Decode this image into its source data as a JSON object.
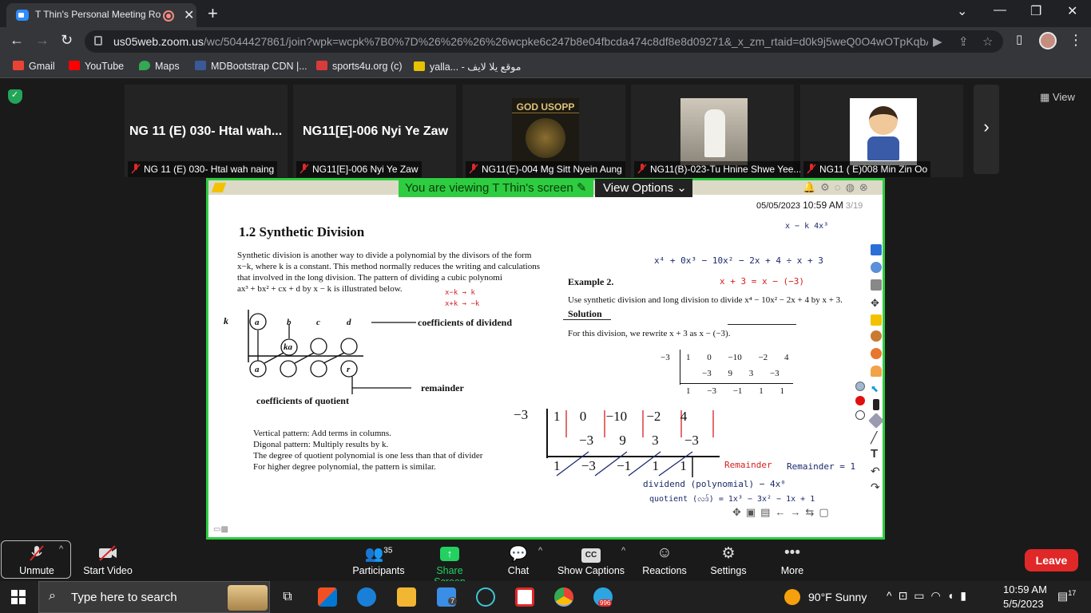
{
  "browser": {
    "tab_title": "T Thin's Personal Meeting Ro",
    "tab_close": "✕",
    "new_tab": "+",
    "url_host": "us05web.zoom.us",
    "url_rest": "/wc/5044427861/join?wpk=wcpk%7B0%7D%26%26%26%26wcpke6c247b8e04fbcda474c8df8e8d09271&_x_zm_rtaid=d0k9j5weQ0O4wOTpKqbA...",
    "window_controls": [
      "⌄",
      "—",
      "❐",
      "✕"
    ]
  },
  "bookmarks": [
    {
      "label": "Gmail",
      "color": "#ea4335"
    },
    {
      "label": "YouTube",
      "color": "#ff0000"
    },
    {
      "label": "Maps",
      "color": "#34a853"
    },
    {
      "label": "MDBootstrap CDN |...",
      "color": "#3b5998"
    },
    {
      "label": "sports4u.org (c)",
      "color": "#d83b3b"
    },
    {
      "label": "yalla... - موقع يلا لايف",
      "color": "#e6c200"
    }
  ],
  "zoom": {
    "view_label": "View",
    "tiles": [
      {
        "big": "NG 11 (E) 030- Htal wah...",
        "name": "NG 11 (E) 030- Htal wah naing"
      },
      {
        "big": "NG11[E]-006 Nyi Ye Zaw",
        "name": "NG11[E]-006 Nyi Ye Zaw"
      },
      {
        "big": "",
        "name": "NG11(E)-004 Mg Sitt Nyein Aung",
        "logo_text": "GOD USOPP"
      },
      {
        "big": "",
        "name": "NG11(B)-023-Tu Hnine Shwe Yee..."
      },
      {
        "big": "",
        "name": "NG11 ( E)008 Min Zin Oo"
      }
    ],
    "share_banner": "You are viewing T Thin's screen",
    "view_options": "View Options",
    "share_date": "05/05/2023",
    "share_time": "10:59 AM",
    "share_page": "3/19"
  },
  "doc": {
    "section_title": "1.2   Synthetic Division",
    "para": [
      "Synthetic division is another way to divide a polynomial by the divisors of the form",
      "x−k, where k is a constant.  This method normally reduces the writing and calculations",
      "that involved in the long division.   The pattern of dividing a cubic polynomi",
      "ax³ + bx² + cx + d by x − k is illustrated below."
    ],
    "diagram": {
      "k": "k",
      "a": "a",
      "b": "b",
      "c": "c",
      "d": "d",
      "ka": "ka",
      "r": "r",
      "coeff_dividend": "coefficients of dividend",
      "remainder": "remainder",
      "coeff_quotient": "coefficients of quotient"
    },
    "patterns": [
      "Vertical pattern:  Add terms in columns.",
      "Digonal pattern:  Multiply results by k.",
      "The degree of quotient polynomial is one less than that of divider",
      "For higher degree polynomial, the pattern is similar."
    ],
    "example_title": "Example 2.",
    "example_text": "Use synthetic division and long division to divide x⁴ − 10x² − 2x + 4 by x + 3.",
    "solution": "Solution",
    "rewrite": "For this division, we rewrite x + 3 as x − (−3).",
    "small_table": {
      "k": "−3",
      "row1": [
        "1",
        "0",
        "−10",
        "−2",
        "4"
      ],
      "row2": [
        "−3",
        "9",
        "3",
        "−3"
      ],
      "row3": [
        "1",
        "−3",
        "−1",
        "1",
        "1"
      ]
    },
    "big_table": {
      "k": "−3",
      "row1": [
        "1",
        "0",
        "−10",
        "−2",
        "4"
      ],
      "row2": [
        "−3",
        "9",
        "3",
        "−3"
      ],
      "row3": [
        "1",
        "−3",
        "−1",
        "1",
        "1"
      ]
    },
    "handwriting": {
      "top_right": "x − k      4x³",
      "dividend_line": "x⁴ + 0x³ − 10x² − 2x + 4   ÷   x + 3",
      "rewrite_line": "x + 3 = x − (−3)",
      "mk1": "x−k → k",
      "mk2": "x+k → −k",
      "remainder_red": "Remainder",
      "remainder_eq": "Remainder = 1",
      "dividend_label": "dividend (polynomial) − 4x⁰",
      "quotient_label": "quotient (လဒ်) = 1x³ − 3x² − 1x + 1"
    }
  },
  "toolbar": {
    "unmute": "Unmute",
    "start_video": "Start Video",
    "participants": "Participants",
    "participants_count": "35",
    "share_screen": "Share Screen",
    "chat": "Chat",
    "show_captions": "Show Captions",
    "reactions": "Reactions",
    "settings": "Settings",
    "more": "More",
    "leave": "Leave"
  },
  "taskbar": {
    "search_placeholder": "Type here to search",
    "weather_temp": "90°F",
    "weather_desc": "Sunny",
    "time": "10:59 AM",
    "date": "5/5/2023",
    "notif_count": "17",
    "mail_badge": "7",
    "telegram_badge": "996"
  }
}
